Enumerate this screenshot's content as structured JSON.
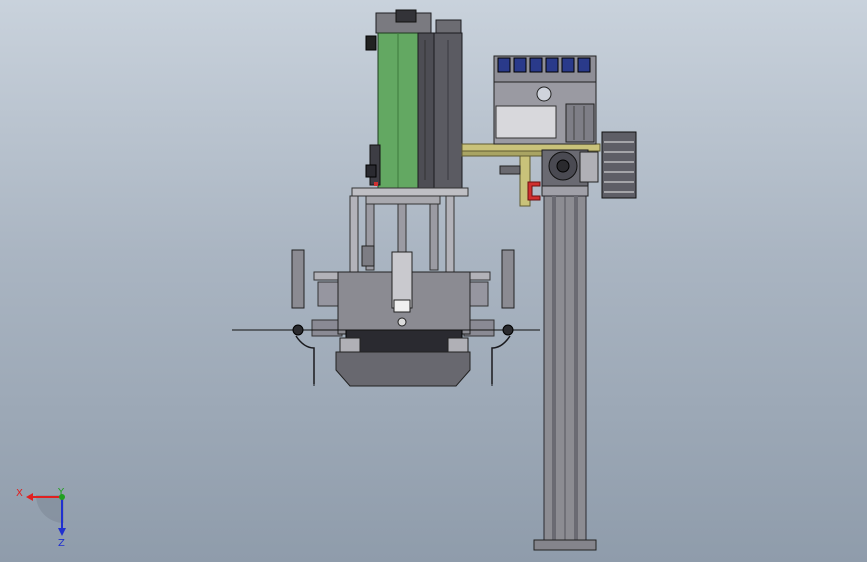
{
  "viewport": {
    "background_top": "#c9d2dc",
    "background_bottom": "#8f9cab"
  },
  "triad": {
    "x_label": "X",
    "y_label": "Y",
    "z_label": "Z",
    "x_color": "#e02020",
    "y_color": "#20a020",
    "z_color": "#2030d0"
  },
  "model": {
    "green_panel_color": "#63a862",
    "frame_color": "#6f6f76",
    "column_color": "#8c8c92",
    "accent_yellow": "#c9c27a",
    "motor_blue": "#2a3a8a",
    "clamp_red": "#d03030"
  }
}
